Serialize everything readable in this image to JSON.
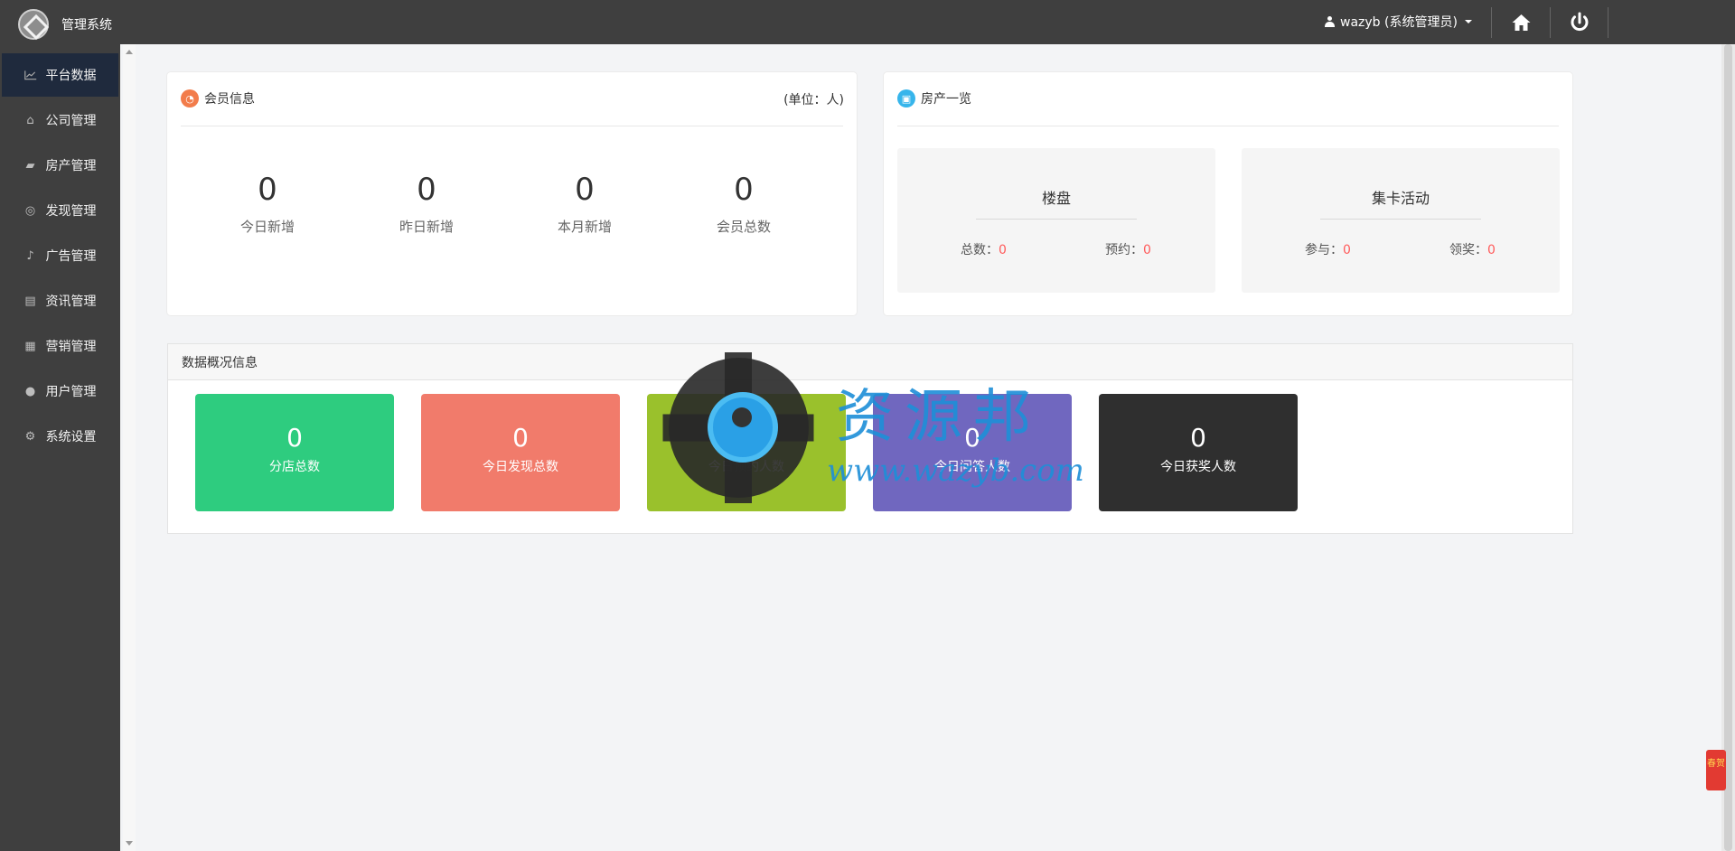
{
  "header": {
    "app_title": "管理系统",
    "user_label": "wazyb (系统管理员)"
  },
  "sidebar": {
    "items": [
      {
        "label": "平台数据",
        "icon": "chart-line-icon"
      },
      {
        "label": "公司管理",
        "icon": "bank-icon"
      },
      {
        "label": "房产管理",
        "icon": "book-icon"
      },
      {
        "label": "发现管理",
        "icon": "life-ring-icon"
      },
      {
        "label": "广告管理",
        "icon": "bell-icon"
      },
      {
        "label": "资讯管理",
        "icon": "newspaper-icon"
      },
      {
        "label": "营销管理",
        "icon": "gift-icon"
      },
      {
        "label": "用户管理",
        "icon": "user-icon"
      },
      {
        "label": "系统设置",
        "icon": "gear-icon"
      }
    ],
    "active_index": 0
  },
  "member_panel": {
    "title": "会员信息",
    "unit": "(单位：人)",
    "stats": [
      {
        "value": "0",
        "label": "今日新增"
      },
      {
        "value": "0",
        "label": "昨日新增"
      },
      {
        "value": "0",
        "label": "本月新增"
      },
      {
        "value": "0",
        "label": "会员总数"
      }
    ]
  },
  "estate_panel": {
    "title": "房产一览",
    "cards": [
      {
        "title": "楼盘",
        "left_label": "总数：",
        "left_value": "0",
        "right_label": "预约：",
        "right_value": "0"
      },
      {
        "title": "集卡活动",
        "left_label": "参与：",
        "left_value": "0",
        "right_label": "领奖：",
        "right_value": "0"
      }
    ]
  },
  "overview": {
    "title": "数据概况信息",
    "tiles": [
      {
        "value": "0",
        "label": "分店总数",
        "color": "#2ecc7f"
      },
      {
        "value": "0",
        "label": "今日发现总数",
        "color": "#f17b6b"
      },
      {
        "value": "0",
        "label": "今日预约人数",
        "color": "#9ac12c"
      },
      {
        "value": "0",
        "label": "今日问答人数",
        "color": "#7067bf"
      },
      {
        "value": "0",
        "label": "今日获奖人数",
        "color": "#2f2f2f"
      }
    ]
  },
  "watermark": {
    "cn": "资源邦",
    "en": "www.wazyb.com"
  },
  "float_badge": {
    "text": "春贺"
  }
}
